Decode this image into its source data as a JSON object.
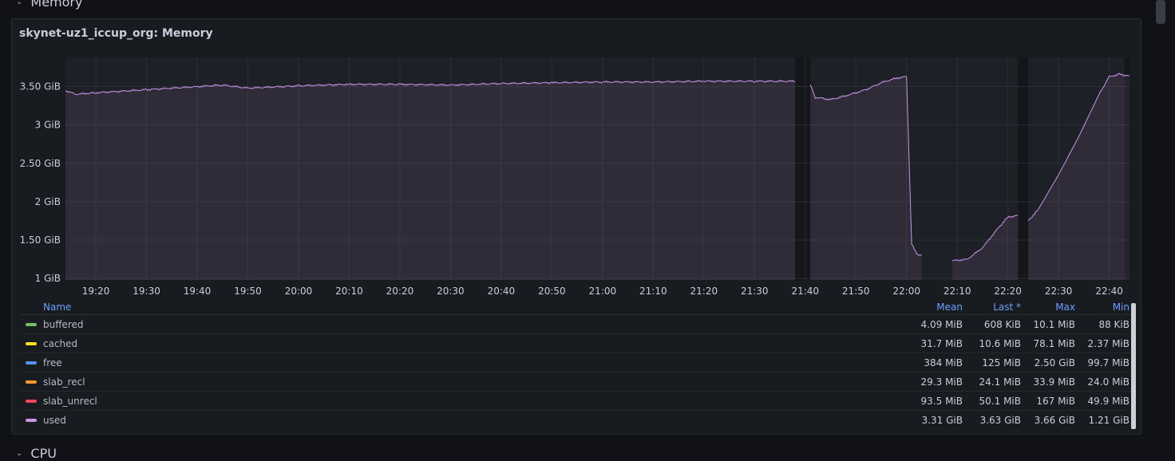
{
  "rows": {
    "memory_label": "Memory",
    "cpu_label": "CPU"
  },
  "panel": {
    "title": "skynet-uz1_iccup_org: Memory"
  },
  "colors": {
    "used": "#ca95e5",
    "buffered": "#73bf69",
    "cached": "#fade2a",
    "free": "#5794f2",
    "slab_recl": "#ff9830",
    "slab_unrecl": "#f2495c",
    "grid": "#2b2e35",
    "text": "#ccccdc",
    "accent": "#6e9fff"
  },
  "chart_data": {
    "type": "area",
    "y_ticks": [
      "1 GiB",
      "1.50 GiB",
      "2 GiB",
      "2.50 GiB",
      "3 GiB",
      "3.50 GiB"
    ],
    "y_tick_values": [
      1,
      1.5,
      2,
      2.5,
      3,
      3.5
    ],
    "ylim": [
      0.98,
      3.88
    ],
    "x_ticks": [
      "19:20",
      "19:30",
      "19:40",
      "19:50",
      "20:00",
      "20:10",
      "20:20",
      "20:30",
      "20:40",
      "20:50",
      "21:00",
      "21:10",
      "21:20",
      "21:30",
      "21:40",
      "21:50",
      "22:00",
      "22:10",
      "22:20",
      "22:30",
      "22:40"
    ],
    "x_tick_values": [
      "19:20",
      "19:30",
      "19:40",
      "19:50",
      "20:00",
      "20:10",
      "20:20",
      "20:30",
      "20:40",
      "20:50",
      "21:00",
      "21:10",
      "21:20",
      "21:30",
      "21:40",
      "21:50",
      "22:00",
      "22:10",
      "22:20",
      "22:30",
      "22:40"
    ],
    "xlim": [
      "19:14",
      "22:44"
    ],
    "grid": true,
    "legend_placement": "bottom",
    "series": [
      {
        "name": "used",
        "unit": "GiB",
        "segments": [
          [
            [
              "19:14",
              3.45
            ],
            [
              "19:16",
              3.4
            ],
            [
              "19:20",
              3.42
            ],
            [
              "19:30",
              3.46
            ],
            [
              "19:40",
              3.5
            ],
            [
              "19:45",
              3.52
            ],
            [
              "19:50",
              3.48
            ],
            [
              "20:00",
              3.51
            ],
            [
              "20:10",
              3.53
            ],
            [
              "20:20",
              3.53
            ],
            [
              "20:30",
              3.52
            ],
            [
              "20:40",
              3.54
            ],
            [
              "20:50",
              3.55
            ],
            [
              "21:00",
              3.56
            ],
            [
              "21:10",
              3.56
            ],
            [
              "21:20",
              3.57
            ],
            [
              "21:30",
              3.57
            ],
            [
              "21:38",
              3.57
            ]
          ],
          [
            [
              "21:41",
              3.52
            ],
            [
              "21:42",
              3.36
            ],
            [
              "21:45",
              3.33
            ],
            [
              "21:48",
              3.38
            ],
            [
              "21:52",
              3.46
            ],
            [
              "21:55",
              3.55
            ],
            [
              "21:58",
              3.61
            ],
            [
              "22:00",
              3.63
            ]
          ],
          [
            [
              "22:00",
              3.63
            ],
            [
              "22:01",
              1.45
            ],
            [
              "22:02",
              1.32
            ],
            [
              "22:03",
              1.3
            ]
          ],
          [
            [
              "22:09",
              1.23
            ],
            [
              "22:12",
              1.25
            ],
            [
              "22:15",
              1.4
            ],
            [
              "22:18",
              1.65
            ],
            [
              "22:20",
              1.8
            ],
            [
              "22:22",
              1.82
            ]
          ],
          [
            [
              "22:24",
              1.75
            ],
            [
              "22:26",
              1.9
            ],
            [
              "22:30",
              2.35
            ],
            [
              "22:34",
              2.85
            ],
            [
              "22:38",
              3.4
            ],
            [
              "22:40",
              3.63
            ],
            [
              "22:42",
              3.66
            ],
            [
              "22:44",
              3.64
            ]
          ]
        ]
      }
    ],
    "gaps": [
      [
        "21:38",
        "21:41"
      ],
      [
        "22:22",
        "22:24"
      ],
      [
        "22:43",
        "22:44"
      ]
    ],
    "legend": {
      "headers": {
        "name": "Name",
        "mean": "Mean",
        "last": "Last *",
        "max": "Max",
        "min": "Min"
      },
      "rows": [
        {
          "name": "buffered",
          "color": "#73bf69",
          "mean": "4.09 MiB",
          "last": "608 KiB",
          "max": "10.1 MiB",
          "min": "88 KiB"
        },
        {
          "name": "cached",
          "color": "#fade2a",
          "mean": "31.7 MiB",
          "last": "10.6 MiB",
          "max": "78.1 MiB",
          "min": "2.37 MiB"
        },
        {
          "name": "free",
          "color": "#5794f2",
          "mean": "384 MiB",
          "last": "125 MiB",
          "max": "2.50 GiB",
          "min": "99.7 MiB"
        },
        {
          "name": "slab_recl",
          "color": "#ff9830",
          "mean": "29.3 MiB",
          "last": "24.1 MiB",
          "max": "33.9 MiB",
          "min": "24.0 MiB"
        },
        {
          "name": "slab_unrecl",
          "color": "#f2495c",
          "mean": "93.5 MiB",
          "last": "50.1 MiB",
          "max": "167 MiB",
          "min": "49.9 MiB"
        },
        {
          "name": "used",
          "color": "#ca95e5",
          "mean": "3.31 GiB",
          "last": "3.63 GiB",
          "max": "3.66 GiB",
          "min": "1.21 GiB"
        }
      ]
    }
  }
}
